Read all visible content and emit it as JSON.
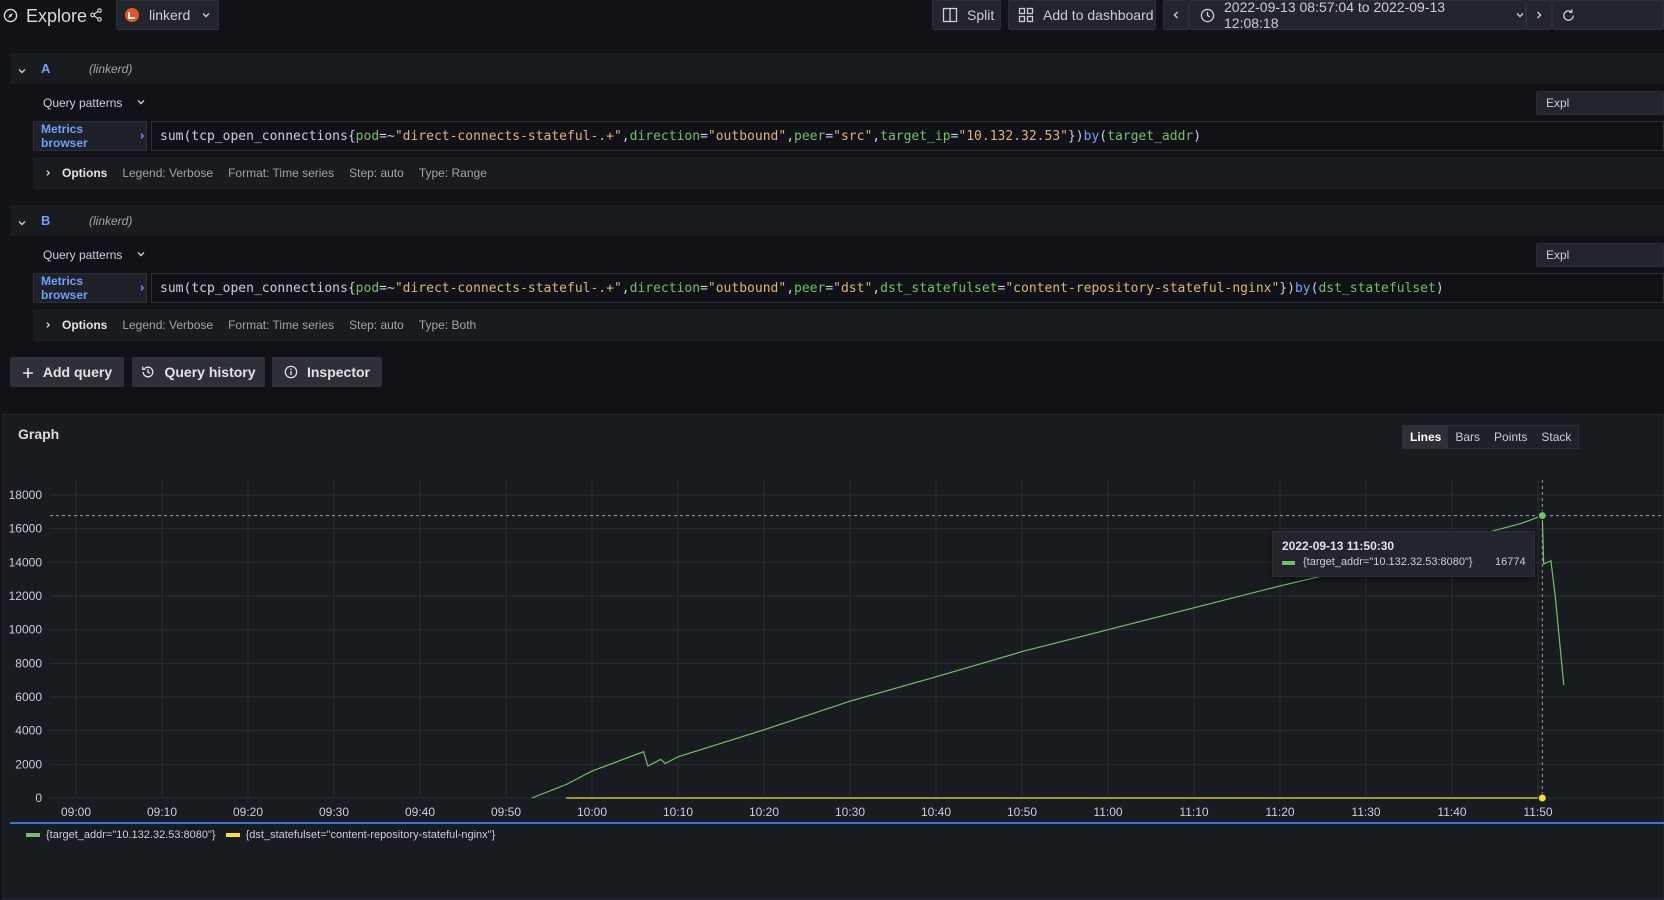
{
  "header": {
    "title": "Explore",
    "datasource": "linkerd",
    "split_label": "Split",
    "add_dashboard_label": "Add to dashboard",
    "time_range": "2022-09-13 08:57:04 to 2022-09-13 12:08:18"
  },
  "queries": [
    {
      "letter": "A",
      "datasource": "(linkerd)",
      "patterns_label": "Query patterns",
      "metrics_label": "Metrics browser",
      "explain_label": "Expl",
      "expr_tokens": [
        {
          "t": "sum(tcp_open_connections{",
          "c": "k-name"
        },
        {
          "t": "pod",
          "c": "k-label"
        },
        {
          "t": "=~",
          "c": "k-name"
        },
        {
          "t": "\"direct-connects-stateful-.+\"",
          "c": "k-str"
        },
        {
          "t": ", ",
          "c": "k-name"
        },
        {
          "t": "direction",
          "c": "k-label"
        },
        {
          "t": "=",
          "c": "k-name"
        },
        {
          "t": "\"outbound\"",
          "c": "k-str"
        },
        {
          "t": ", ",
          "c": "k-name"
        },
        {
          "t": "peer",
          "c": "k-label"
        },
        {
          "t": "=",
          "c": "k-name"
        },
        {
          "t": "\"src\"",
          "c": "k-str"
        },
        {
          "t": ", ",
          "c": "k-name"
        },
        {
          "t": "target_ip",
          "c": "k-label"
        },
        {
          "t": "=",
          "c": "k-name"
        },
        {
          "t": "\"10.132.32.53\"",
          "c": "k-str"
        },
        {
          "t": "}) ",
          "c": "k-name"
        },
        {
          "t": "by",
          "c": "k-kw"
        },
        {
          "t": " (",
          "c": "k-name"
        },
        {
          "t": "target_addr",
          "c": "k-label"
        },
        {
          "t": ")",
          "c": "k-name"
        }
      ],
      "options_label": "Options",
      "legend": "Legend: Verbose",
      "format": "Format: Time series",
      "step": "Step: auto",
      "type": "Type: Range"
    },
    {
      "letter": "B",
      "datasource": "(linkerd)",
      "patterns_label": "Query patterns",
      "metrics_label": "Metrics browser",
      "explain_label": "Expl",
      "expr_tokens": [
        {
          "t": "sum(tcp_open_connections{",
          "c": "k-name"
        },
        {
          "t": "pod",
          "c": "k-label"
        },
        {
          "t": "=~",
          "c": "k-name"
        },
        {
          "t": "\"direct-connects-stateful-.+\"",
          "c": "k-str"
        },
        {
          "t": ", ",
          "c": "k-name"
        },
        {
          "t": "direction",
          "c": "k-label"
        },
        {
          "t": "=",
          "c": "k-name"
        },
        {
          "t": "\"outbound\"",
          "c": "k-str"
        },
        {
          "t": ", ",
          "c": "k-name"
        },
        {
          "t": "peer",
          "c": "k-label"
        },
        {
          "t": "=",
          "c": "k-name"
        },
        {
          "t": "\"dst\"",
          "c": "k-str"
        },
        {
          "t": ", ",
          "c": "k-name"
        },
        {
          "t": "dst_statefulset",
          "c": "k-label"
        },
        {
          "t": "=",
          "c": "k-name"
        },
        {
          "t": "\"content-repository-stateful-nginx\"",
          "c": "k-str"
        },
        {
          "t": "}) ",
          "c": "k-name"
        },
        {
          "t": "by",
          "c": "k-kw"
        },
        {
          "t": " (",
          "c": "k-name"
        },
        {
          "t": "dst_statefulset",
          "c": "k-label"
        },
        {
          "t": ")",
          "c": "k-name"
        }
      ],
      "options_label": "Options",
      "legend": "Legend: Verbose",
      "format": "Format: Time series",
      "step": "Step: auto",
      "type": "Type: Both"
    }
  ],
  "actions": {
    "add_query": "Add query",
    "query_history": "Query history",
    "inspector": "Inspector"
  },
  "graph": {
    "title": "Graph",
    "modes": [
      "Lines",
      "Bars",
      "Points",
      "Stack"
    ],
    "active_mode": "Lines",
    "tooltip": {
      "time": "2022-09-13 11:50:30",
      "series": "{target_addr=\"10.132.32.53:8080\"}",
      "value": "16774"
    }
  },
  "chart_data": {
    "type": "line",
    "title": "",
    "xlabel": "",
    "ylabel": "",
    "x_ticks": [
      "09:00",
      "09:10",
      "09:20",
      "09:30",
      "09:40",
      "09:50",
      "10:00",
      "10:10",
      "10:20",
      "10:30",
      "10:40",
      "10:50",
      "11:00",
      "11:10",
      "11:20",
      "11:30",
      "11:40",
      "11:50"
    ],
    "y_ticks": [
      0,
      2000,
      4000,
      6000,
      8000,
      10000,
      12000,
      14000,
      16000,
      18000
    ],
    "ylim": [
      0,
      18000
    ],
    "grid": true,
    "legend_position": "bottom",
    "series": [
      {
        "name": "{target_addr=\"10.132.32.53:8080\"}",
        "color": "#73bf69",
        "points": [
          [
            "09:53",
            0
          ],
          [
            "09:57",
            800
          ],
          [
            "10:00",
            1600
          ],
          [
            "10:06",
            2750
          ],
          [
            "10:06:30",
            1900
          ],
          [
            "10:08",
            2300
          ],
          [
            "10:08:30",
            2050
          ],
          [
            "10:10",
            2450
          ],
          [
            "10:20",
            4050
          ],
          [
            "10:30",
            5750
          ],
          [
            "10:40",
            7200
          ],
          [
            "10:50",
            8700
          ],
          [
            "11:00",
            10000
          ],
          [
            "11:10",
            11300
          ],
          [
            "11:20",
            12600
          ],
          [
            "11:25",
            13200
          ],
          [
            "11:48",
            16300
          ],
          [
            "11:50:30",
            16774
          ],
          [
            "11:50:40",
            13900
          ],
          [
            "11:51:30",
            14100
          ],
          [
            "11:52",
            12000
          ],
          [
            "11:53",
            6700
          ]
        ]
      },
      {
        "name": "{dst_statefulset=\"content-repository-stateful-nginx\"}",
        "color": "#fade2a",
        "points": [
          [
            "09:57",
            0
          ],
          [
            "09:59",
            0
          ],
          [
            "10:01",
            0
          ],
          [
            "11:50:30",
            0
          ]
        ]
      }
    ]
  }
}
